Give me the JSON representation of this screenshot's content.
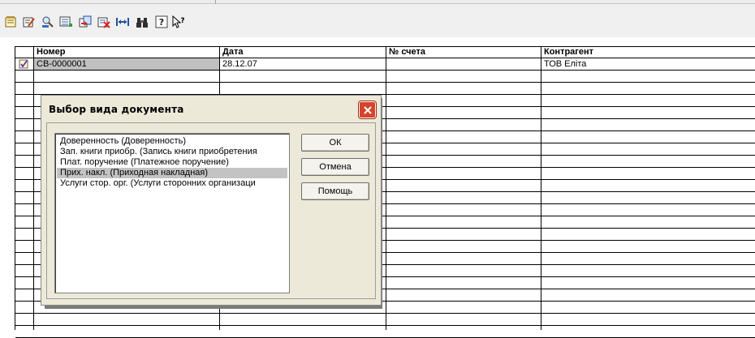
{
  "toolbar": {
    "icons": [
      "new-document-icon",
      "edit-document-icon",
      "find-icon",
      "list-icon",
      "copy-document-icon",
      "delete-document-icon",
      "width-icon",
      "binoculars-icon",
      "help-icon",
      "context-help-icon"
    ]
  },
  "table": {
    "headers": [
      "Номер",
      "Дата",
      "№ счета",
      "Контрагент"
    ],
    "rows": [
      {
        "number": "СВ-0000001",
        "date": "28.12.07",
        "invoice": "",
        "counterparty": "ТОВ Еліта"
      }
    ]
  },
  "dialog": {
    "title": "Выбор вида документа",
    "items": [
      "Доверенность (Доверенность)",
      "Зап. книги приобр. (Запись книги приобретения",
      "Плат. поручение (Платежное поручение)",
      "Прих. накл. (Приходная накладная)",
      "Услуги стор. орг. (Услуги сторонних организаци"
    ],
    "selected_index": 3,
    "buttons": {
      "ok": "ОК",
      "cancel": "Отмена",
      "help": "Помощь"
    }
  },
  "colors": {
    "close_button": "#d6442b",
    "selection": "#c3c3c3",
    "dialog_bg": "#ece9d8"
  }
}
